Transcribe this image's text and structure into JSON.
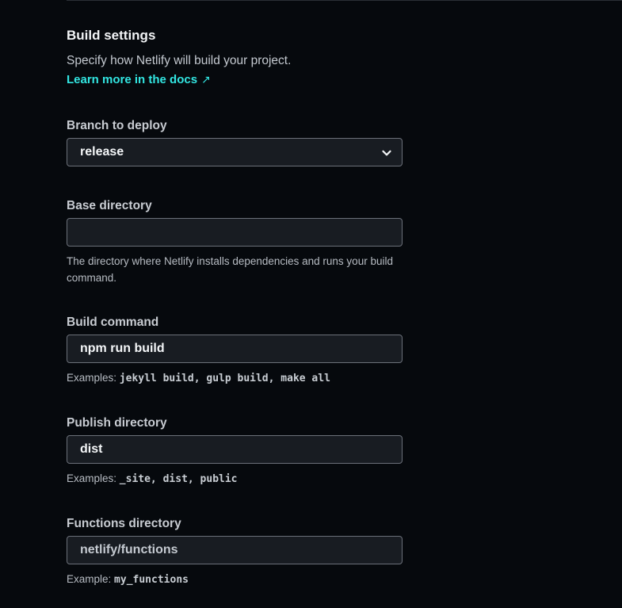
{
  "section": {
    "title": "Build settings",
    "description": "Specify how Netlify will build your project.",
    "docs_link": "Learn more in the docs",
    "docs_link_icon": "arrow-up-right-icon"
  },
  "branch": {
    "label": "Branch to deploy",
    "value": "release",
    "icon": "chevron-down-icon"
  },
  "base_directory": {
    "label": "Base directory",
    "value": "",
    "help": "The directory where Netlify installs dependencies and runs your build command."
  },
  "build_command": {
    "label": "Build command",
    "value": "npm run build",
    "help_prefix": "Examples:",
    "help_examples": "jekyll build, gulp build, make all"
  },
  "publish_directory": {
    "label": "Publish directory",
    "value": "dist",
    "help_prefix": "Examples:",
    "help_examples": "_site, dist, public"
  },
  "functions_directory": {
    "label": "Functions directory",
    "value": "netlify/functions",
    "help_prefix": "Example:",
    "help_examples": "my_functions"
  },
  "colors": {
    "background": "#06090d",
    "accent_link": "#32e6e2",
    "input_border": "#6b7079",
    "input_background": "#181c22"
  }
}
